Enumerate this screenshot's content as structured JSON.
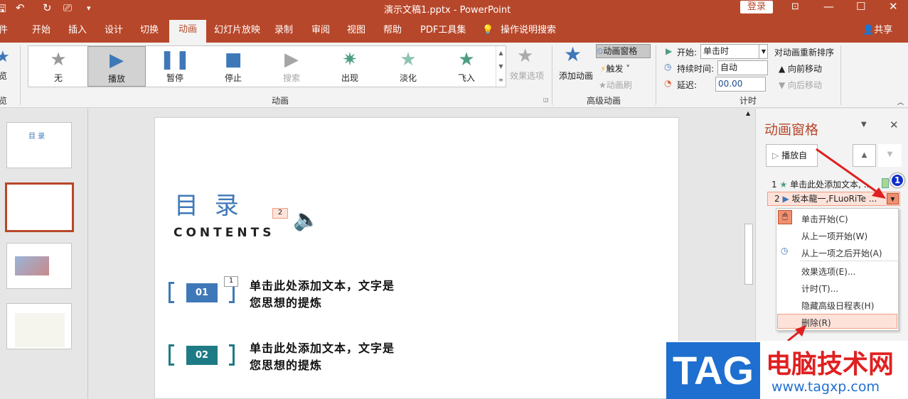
{
  "titlebar": {
    "doc_title": "演示文稿1.pptx  -  PowerPoint",
    "login": "登录",
    "qa_more": "▾"
  },
  "tabs": [
    "件",
    "开始",
    "插入",
    "设计",
    "切换",
    "动画",
    "幻灯片放映",
    "录制",
    "审阅",
    "视图",
    "帮助",
    "PDF工具集",
    "操作说明搜索"
  ],
  "share": "共享",
  "ribbon": {
    "preview": {
      "label": "览",
      "group": "览"
    },
    "gallery": [
      {
        "label": "无",
        "icon": "star-gray"
      },
      {
        "label": "播放",
        "icon": "play",
        "selected": true
      },
      {
        "label": "暂停",
        "icon": "pause"
      },
      {
        "label": "停止",
        "icon": "stop"
      },
      {
        "label": "搜索",
        "icon": "seek",
        "disabled": true
      },
      {
        "label": "出现",
        "icon": "star-green"
      },
      {
        "label": "淡化",
        "icon": "star-fade"
      },
      {
        "label": "飞入",
        "icon": "star-fly"
      }
    ],
    "effect_options": "效果选项",
    "anim_group": "动画",
    "add_animation": "添加动画",
    "anim_pane": "动画窗格",
    "trigger": "触发",
    "anim_painter": "动画刷",
    "advanced_group": "高级动画",
    "start_label": "开始:",
    "start_value": "单击时",
    "duration_label": "持续时间:",
    "duration_value": "自动",
    "delay_label": "延迟:",
    "delay_value": "00.00",
    "timing_group": "计时",
    "reorder": "对动画重新排序",
    "move_earlier": "向前移动",
    "move_later": "向后移动"
  },
  "slide": {
    "title": "目 录",
    "subtitle": "CONTENTS",
    "anim_tag_2": "2",
    "anim_tag_1": "1",
    "items": [
      {
        "num": "01",
        "line1": "单击此处添加文本，文字是",
        "line2": "您思想的提炼"
      },
      {
        "num": "02",
        "line1": "单击此处添加文本，文字是",
        "line2": "您思想的提炼"
      }
    ]
  },
  "thumb1_title": "目 录",
  "pane": {
    "title": "动画窗格",
    "play_from": "播放自",
    "items": [
      {
        "num": "1",
        "label": "单击此处添加文本, ..."
      },
      {
        "num": "2",
        "label": "坂本龍一,FLuoRiTe ..."
      }
    ],
    "badge": "1",
    "menu": [
      "单击开始(C)",
      "从上一项开始(W)",
      "从上一项之后开始(A)",
      "效果选项(E)...",
      "计时(T)...",
      "隐藏高级日程表(H)",
      "删除(R)"
    ]
  },
  "watermark": {
    "logo": "TAG",
    "site": "电脑技术网",
    "url": "www.tagxp.com"
  },
  "colors": {
    "accent": "#b7472a",
    "blue": "#3f78b8",
    "teal": "#1e7b85"
  }
}
